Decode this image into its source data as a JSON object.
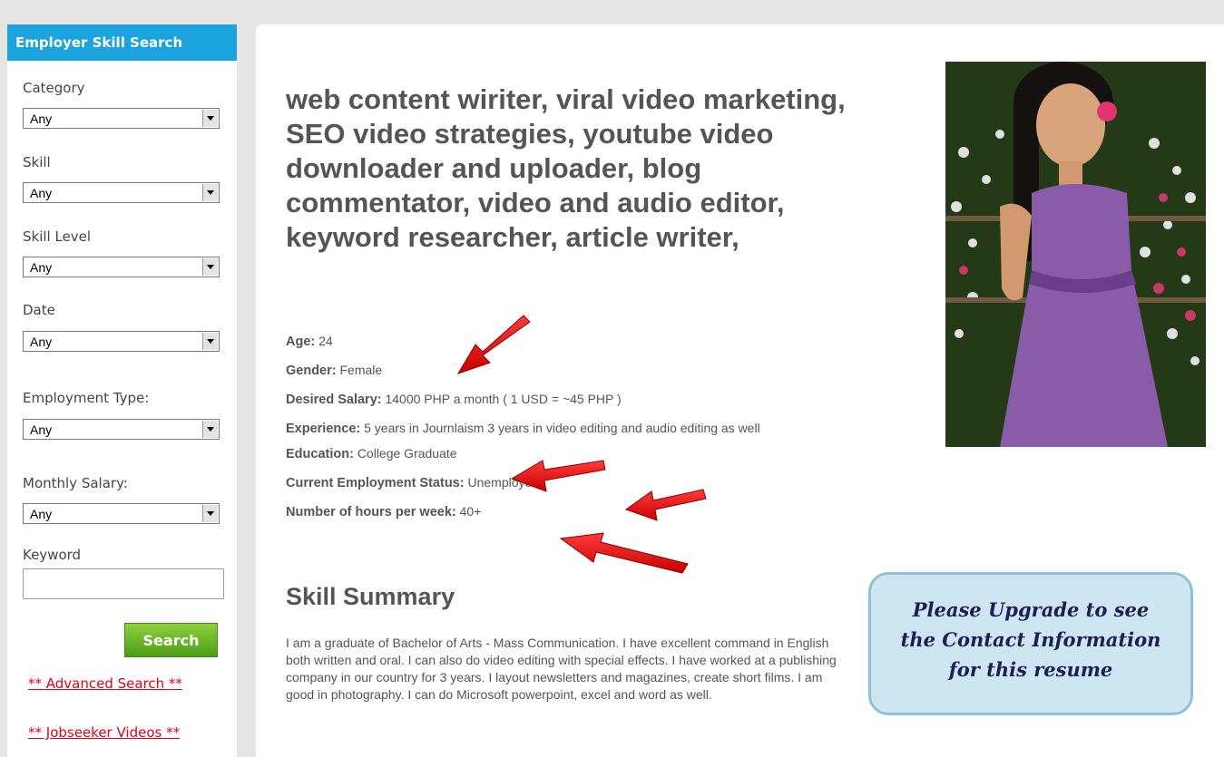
{
  "sidebar": {
    "title": "Employer Skill Search",
    "fields": [
      {
        "label": "Category",
        "value": "Any"
      },
      {
        "label": "Skill",
        "value": "Any"
      },
      {
        "label": "Skill Level",
        "value": "Any"
      },
      {
        "label": "Date",
        "value": "Any"
      },
      {
        "label": "Employment Type:",
        "value": "Any"
      },
      {
        "label": "Monthly Salary:",
        "value": "Any"
      }
    ],
    "keyword_label": "Keyword",
    "keyword_value": "",
    "search_label": "Search",
    "advanced_search_link": "** Advanced Search **",
    "jobseeker_videos_link": "** Jobseeker Videos **"
  },
  "profile": {
    "headline": "web content wiriter, viral video marketing, SEO video strategies, youtube video downloader and uploader, blog commentator, video and audio editor, keyword researcher, article writer,",
    "details": [
      {
        "key": "Age:",
        "value": "24"
      },
      {
        "key": "Gender:",
        "value": "Female"
      },
      {
        "key": "Desired Salary:",
        "value": "14000 PHP a month ( 1 USD = ~45 PHP )"
      },
      {
        "key": "Experience:",
        "value": "5 years in Journlaism 3 years in video editing and audio editing as well"
      },
      {
        "key": "Education:",
        "value": "College Graduate"
      },
      {
        "key": "Current Employment Status:",
        "value": "Unemployed"
      },
      {
        "key": "Number of hours per week:",
        "value": "40+"
      }
    ],
    "skill_summary_title": "Skill Summary",
    "skill_summary_text": "I am a graduate of Bachelor of Arts - Mass Communication. I have excellent command in English both written and oral. I can also do video editing with special effects. I have worked at a publishing company in our country for 3 years. I layout newsletters and magazines, create short films. I am good in photography. I can do Microsoft powerpoint, excel and word as well."
  },
  "upgrade_notice": {
    "line1": "Please Upgrade to see",
    "line2": "the Contact Information",
    "line3": "for this resume"
  },
  "colors": {
    "sidebar_header": "#1aa3dc",
    "search_button": "#6ab82a",
    "link_red": "#e3001b",
    "arrow_red": "#e8121a",
    "upgrade_bg": "#cde6f2"
  }
}
